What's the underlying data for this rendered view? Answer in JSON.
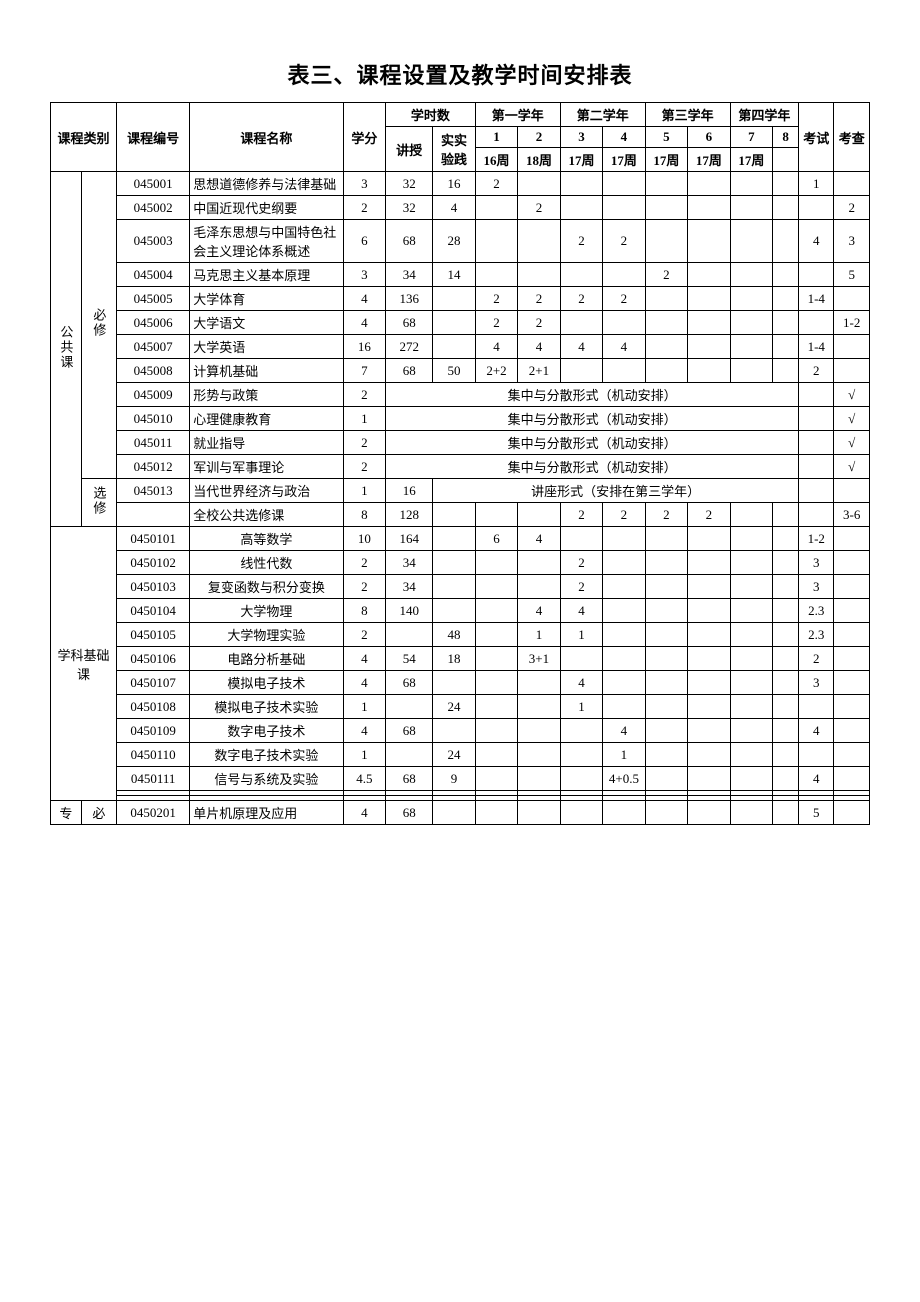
{
  "title": "表三、课程设置及教学时间安排表",
  "head": {
    "cat": "课程类别",
    "num": "课程编号",
    "name": "课程名称",
    "credit": "学分",
    "hours": "学时数",
    "lecture": "讲授",
    "lab": "实实验践",
    "y1": "第一学年",
    "y2": "第二学年",
    "y3": "第三学年",
    "y4": "第四学年",
    "sem": [
      "1",
      "2",
      "3",
      "4",
      "5",
      "6",
      "7",
      "8"
    ],
    "weeks": [
      "16周",
      "18周",
      "17周",
      "17周",
      "17周",
      "17周",
      "17周",
      ""
    ],
    "kaoshi": "考试",
    "kaocha": "考查"
  },
  "groups": [
    {
      "cat1": "公共课",
      "sub": [
        {
          "cat2": "必修",
          "rows": [
            {
              "num": "045001",
              "name": "思想道德修养与法律基础",
              "credit": "3",
              "lec": "32",
              "lab": "16",
              "s": [
                "2",
                "",
                "",
                "",
                "",
                "",
                "",
                ""
              ],
              "ks": "1",
              "kc": "",
              "nameClass": "name-cell"
            },
            {
              "num": "045002",
              "name": "中国近现代史纲要",
              "credit": "2",
              "lec": "32",
              "lab": "4",
              "s": [
                "",
                "2",
                "",
                "",
                "",
                "",
                "",
                ""
              ],
              "ks": "",
              "kc": "2",
              "nameClass": "name-cell"
            },
            {
              "num": "045003",
              "name": "毛泽东思想与中国特色社会主义理论体系概述",
              "credit": "6",
              "lec": "68",
              "lab": "28",
              "s": [
                "",
                "",
                "2",
                "2",
                "",
                "",
                "",
                ""
              ],
              "ks": "4",
              "kc": "3",
              "nameClass": "name-cell"
            },
            {
              "num": "045004",
              "name": "马克思主义基本原理",
              "credit": "3",
              "lec": "34",
              "lab": "14",
              "s": [
                "",
                "",
                "",
                "",
                "2",
                "",
                "",
                ""
              ],
              "ks": "",
              "kc": "5",
              "nameClass": "name-cell"
            },
            {
              "num": "045005",
              "name": "大学体育",
              "credit": "4",
              "lec": "136",
              "lab": "",
              "s": [
                "2",
                "2",
                "2",
                "2",
                "",
                "",
                "",
                ""
              ],
              "ks": "1-4",
              "kc": "",
              "nameClass": "name-cell"
            },
            {
              "num": "045006",
              "name": "大学语文",
              "credit": "4",
              "lec": "68",
              "lab": "",
              "s": [
                "2",
                "2",
                "",
                "",
                "",
                "",
                "",
                ""
              ],
              "ks": "",
              "kc": "1-2",
              "nameClass": "name-cell"
            },
            {
              "num": "045007",
              "name": "大学英语",
              "credit": "16",
              "lec": "272",
              "lab": "",
              "s": [
                "4",
                "4",
                "4",
                "4",
                "",
                "",
                "",
                ""
              ],
              "ks": "1-4",
              "kc": "",
              "nameClass": "name-cell"
            },
            {
              "num": "045008",
              "name": "计算机基础",
              "credit": "7",
              "lec": "68",
              "lab": "50",
              "s": [
                "2+2",
                "2+1",
                "",
                "",
                "",
                "",
                "",
                ""
              ],
              "ks": "2",
              "kc": "",
              "nameClass": "name-cell"
            },
            {
              "num": "045009",
              "name": "形势与政策",
              "credit": "2",
              "merged": "集中与分散形式（机动安排）",
              "ks": "",
              "kc": "√",
              "nameClass": "name-cell"
            },
            {
              "num": "045010",
              "name": "心理健康教育",
              "credit": "1",
              "merged": "集中与分散形式（机动安排）",
              "ks": "",
              "kc": "√",
              "nameClass": "name-cell"
            },
            {
              "num": "045011",
              "name": "就业指导",
              "credit": "2",
              "merged": "集中与分散形式（机动安排）",
              "ks": "",
              "kc": "√",
              "nameClass": "name-cell"
            },
            {
              "num": "045012",
              "name": "军训与军事理论",
              "credit": "2",
              "merged": "集中与分散形式（机动安排）",
              "ks": "",
              "kc": "√",
              "nameClass": "name-cell"
            }
          ]
        },
        {
          "cat2": "选修",
          "rows": [
            {
              "num": "045013",
              "name": "当代世界经济与政治",
              "credit": "1",
              "lec": "16",
              "merged9": "讲座形式（安排在第三学年）",
              "ks": "",
              "kc": "",
              "nameClass": "name-cell"
            },
            {
              "num": "",
              "name": "全校公共选修课",
              "credit": "8",
              "lec": "128",
              "lab": "",
              "s": [
                "",
                "",
                "2",
                "2",
                "2",
                "2",
                "",
                ""
              ],
              "ks": "",
              "kc": "3-6",
              "nameClass": "name-cell"
            }
          ]
        }
      ]
    },
    {
      "cat1": "学科基础课",
      "cat1Span": 2,
      "sub": [
        {
          "cat2": "",
          "rows": [
            {
              "num": "0450101",
              "name": "高等数学",
              "credit": "10",
              "lec": "164",
              "lab": "",
              "s": [
                "6",
                "4",
                "",
                "",
                "",
                "",
                "",
                ""
              ],
              "ks": "1-2",
              "kc": "",
              "nameClass": "center-name"
            },
            {
              "num": "0450102",
              "name": "线性代数",
              "credit": "2",
              "lec": "34",
              "lab": "",
              "s": [
                "",
                "",
                "2",
                "",
                "",
                "",
                "",
                ""
              ],
              "ks": "3",
              "kc": "",
              "nameClass": "center-name"
            },
            {
              "num": "0450103",
              "name": "复变函数与积分变换",
              "credit": "2",
              "lec": "34",
              "lab": "",
              "s": [
                "",
                "",
                "2",
                "",
                "",
                "",
                "",
                ""
              ],
              "ks": "3",
              "kc": "",
              "nameClass": "center-name"
            },
            {
              "num": "0450104",
              "name": "大学物理",
              "credit": "8",
              "lec": "140",
              "lab": "",
              "s": [
                "",
                "4",
                "4",
                "",
                "",
                "",
                "",
                ""
              ],
              "ks": "2.3",
              "kc": "",
              "nameClass": "center-name"
            },
            {
              "num": "0450105",
              "name": "大学物理实验",
              "credit": "2",
              "lec": "",
              "lab": "48",
              "s": [
                "",
                "1",
                "1",
                "",
                "",
                "",
                "",
                ""
              ],
              "ks": "2.3",
              "kc": "",
              "nameClass": "center-name"
            },
            {
              "num": "0450106",
              "name": "电路分析基础",
              "credit": "4",
              "lec": "54",
              "lab": "18",
              "s": [
                "",
                "3+1",
                "",
                "",
                "",
                "",
                "",
                ""
              ],
              "ks": "2",
              "kc": "",
              "nameClass": "center-name"
            },
            {
              "num": "0450107",
              "name": "模拟电子技术",
              "credit": "4",
              "lec": "68",
              "lab": "",
              "s": [
                "",
                "",
                "4",
                "",
                "",
                "",
                "",
                ""
              ],
              "ks": "3",
              "kc": "",
              "nameClass": "center-name"
            },
            {
              "num": "0450108",
              "name": "模拟电子技术实验",
              "credit": "1",
              "lec": "",
              "lab": "24",
              "s": [
                "",
                "",
                "1",
                "",
                "",
                "",
                "",
                ""
              ],
              "ks": "",
              "kc": "",
              "nameClass": "center-name"
            },
            {
              "num": "0450109",
              "name": "数字电子技术",
              "credit": "4",
              "lec": "68",
              "lab": "",
              "s": [
                "",
                "",
                "",
                "4",
                "",
                "",
                "",
                ""
              ],
              "ks": "4",
              "kc": "",
              "nameClass": "center-name"
            },
            {
              "num": "0450110",
              "name": "数字电子技术实验",
              "credit": "1",
              "lec": "",
              "lab": "24",
              "s": [
                "",
                "",
                "",
                "1",
                "",
                "",
                "",
                ""
              ],
              "ks": "",
              "kc": "",
              "nameClass": "center-name"
            },
            {
              "num": "0450111",
              "name": "信号与系统及实验",
              "credit": "4.5",
              "lec": "68",
              "lab": "9",
              "s": [
                "",
                "",
                "",
                "4+0.5",
                "",
                "",
                "",
                ""
              ],
              "ks": "4",
              "kc": "",
              "nameClass": "center-name"
            },
            {
              "num": "",
              "name": "",
              "credit": "",
              "lec": "",
              "lab": "",
              "s": [
                "",
                "",
                "",
                "",
                "",
                "",
                "",
                ""
              ],
              "ks": "",
              "kc": ""
            },
            {
              "num": "",
              "name": "",
              "credit": "",
              "lec": "",
              "lab": "",
              "s": [
                "",
                "",
                "",
                "",
                "",
                "",
                "",
                ""
              ],
              "ks": "",
              "kc": ""
            }
          ]
        }
      ]
    },
    {
      "cat1": "专",
      "cat1Raw": true,
      "sub": [
        {
          "cat2": "必",
          "cat2Raw": true,
          "rows": [
            {
              "num": "0450201",
              "name": "单片机原理及应用",
              "credit": "4",
              "lec": "68",
              "lab": "",
              "s": [
                "",
                "",
                "",
                "",
                "",
                "",
                "",
                ""
              ],
              "ks": "5",
              "kc": "",
              "nameClass": "name-cell"
            }
          ]
        }
      ]
    }
  ]
}
